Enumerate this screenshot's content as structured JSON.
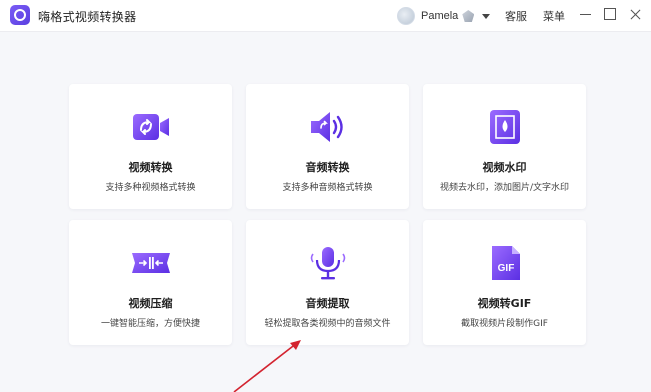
{
  "app": {
    "title": "嗨格式视频转换器",
    "username": "Pamela",
    "support_label": "客服",
    "menu_label": "菜单"
  },
  "colors": {
    "accent": "#7c4dff",
    "accent_dark": "#5b2fe3",
    "annotation": "#d3232f"
  },
  "features": [
    {
      "title": "视频转换",
      "desc": "支持多种视频格式转换",
      "icon": "video-convert-icon"
    },
    {
      "title": "音频转换",
      "desc": "支持多种音频格式转换",
      "icon": "audio-convert-icon"
    },
    {
      "title": "视频水印",
      "desc": "视频去水印，添加图片/文字水印",
      "icon": "watermark-icon"
    },
    {
      "title": "视频压缩",
      "desc": "一键智能压缩，方便快捷",
      "icon": "compress-icon"
    },
    {
      "title": "音频提取",
      "desc": "轻松提取各类视频中的音频文件",
      "icon": "microphone-icon"
    },
    {
      "title": "视频转GIF",
      "desc": "截取视频片段制作GIF",
      "icon": "gif-file-icon",
      "badge": "GIF"
    }
  ]
}
